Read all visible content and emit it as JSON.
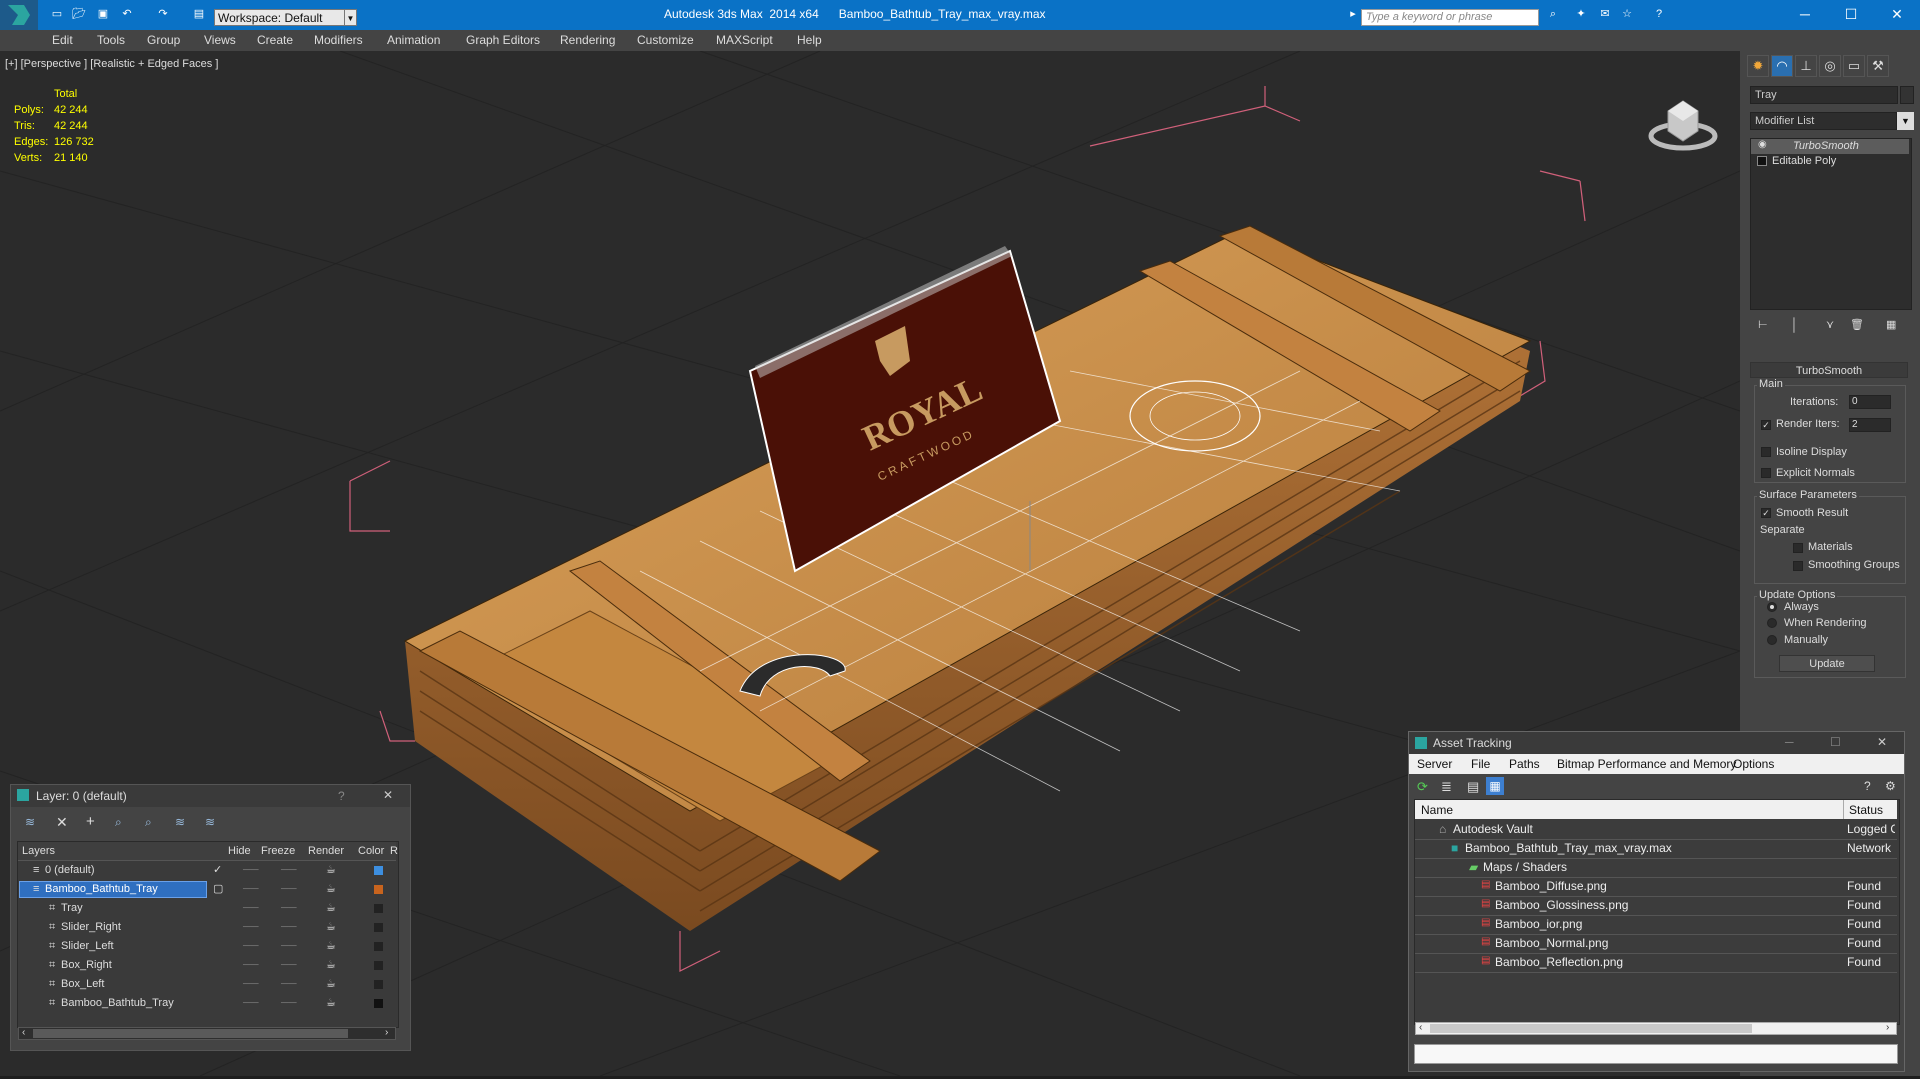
{
  "app": {
    "title": "Autodesk 3ds Max  2014 x64      Bamboo_Bathtub_Tray_max_vray.max",
    "workspace": "Workspace: Default",
    "search_placeholder": "Type a keyword or phrase",
    "accent": "#0a72c6"
  },
  "menu": [
    "Edit",
    "Tools",
    "Group",
    "Views",
    "Create",
    "Modifiers",
    "Animation",
    "Graph Editors",
    "Rendering",
    "Customize",
    "MAXScript",
    "Help"
  ],
  "viewport": {
    "label": "[+] [Perspective ] [Realistic + Edged Faces ]",
    "stats": {
      "header": "Total",
      "rows": [
        {
          "label": "Polys:",
          "value": "42 244"
        },
        {
          "label": "Tris:",
          "value": "42 244"
        },
        {
          "label": "Edges:",
          "value": "126 732"
        },
        {
          "label": "Verts:",
          "value": "21 140"
        }
      ]
    },
    "sign_text": "ROYAL",
    "sign_subtext": "CRAFTWOOD"
  },
  "command_panel": {
    "object_name": "Tray",
    "modifier_list": "Modifier List",
    "stack": [
      "TurboSmooth",
      "Editable Poly"
    ],
    "turbosmooth": {
      "header": "TurboSmooth",
      "main_label": "Main",
      "iterations_label": "Iterations:",
      "iterations_value": "0",
      "render_iters_label": "Render Iters:",
      "render_iters_value": "2",
      "isoline_label": "Isoline Display",
      "explicit_label": "Explicit Normals",
      "surface_label": "Surface Parameters",
      "smooth_label": "Smooth Result",
      "separate_label": "Separate",
      "materials_label": "Materials",
      "smoothing_label": "Smoothing Groups",
      "update_options_label": "Update Options",
      "always_label": "Always",
      "when_rendering_label": "When Rendering",
      "manually_label": "Manually",
      "update_button": "Update"
    }
  },
  "layer_panel": {
    "title": "Layer: 0 (default)",
    "columns": [
      "Layers",
      "Hide",
      "Freeze",
      "Render",
      "Color",
      "R"
    ],
    "rows": [
      {
        "name": "0 (default)",
        "color": "#3d8fe0",
        "indent": 1
      },
      {
        "name": "Bamboo_Bathtub_Tray",
        "color": "#c8641e",
        "indent": 1,
        "selected": true
      },
      {
        "name": "Tray",
        "color": "#222222",
        "indent": 2
      },
      {
        "name": "Slider_Right",
        "color": "#222222",
        "indent": 2
      },
      {
        "name": "Slider_Left",
        "color": "#222222",
        "indent": 2
      },
      {
        "name": "Box_Right",
        "color": "#222222",
        "indent": 2
      },
      {
        "name": "Box_Left",
        "color": "#222222",
        "indent": 2
      },
      {
        "name": "Bamboo_Bathtub_Tray",
        "color": "#111111",
        "indent": 2
      }
    ]
  },
  "asset_tracking": {
    "title": "Asset Tracking",
    "menu": [
      "Server",
      "File",
      "Paths",
      "Bitmap Performance and Memory",
      "Options"
    ],
    "columns": [
      "Name",
      "Status"
    ],
    "rows": [
      {
        "name": "Autodesk Vault",
        "status": "Logged Ou",
        "indent": 1
      },
      {
        "name": "Bamboo_Bathtub_Tray_max_vray.max",
        "status": "Network Pa",
        "indent": 2
      },
      {
        "name": "Maps / Shaders",
        "status": "",
        "indent": 3
      },
      {
        "name": "Bamboo_Diffuse.png",
        "status": "Found",
        "indent": 4
      },
      {
        "name": "Bamboo_Glossiness.png",
        "status": "Found",
        "indent": 4
      },
      {
        "name": "Bamboo_ior.png",
        "status": "Found",
        "indent": 4
      },
      {
        "name": "Bamboo_Normal.png",
        "status": "Found",
        "indent": 4
      },
      {
        "name": "Bamboo_Reflection.png",
        "status": "Found",
        "indent": 4
      }
    ]
  }
}
